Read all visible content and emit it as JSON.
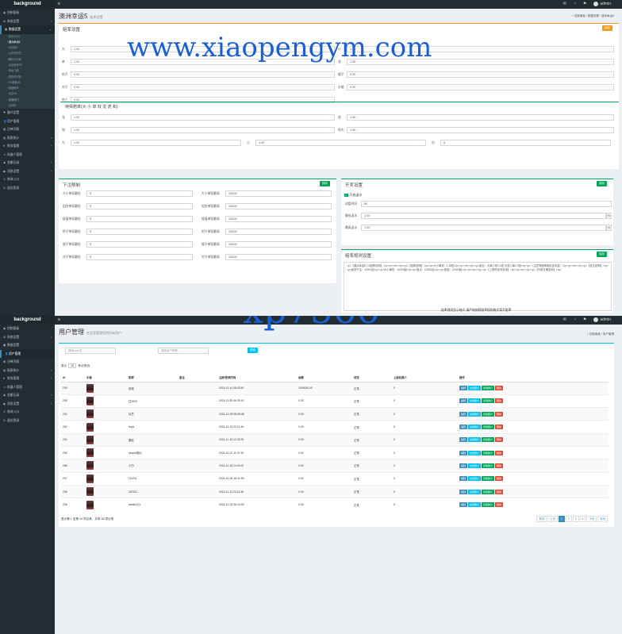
{
  "app": {
    "brand": "background",
    "user": "admin",
    "toggle_icon": "≡"
  },
  "sidebar1": [
    {
      "icon": "dashboard-icon",
      "glyph": "◉",
      "label": "控制面板",
      "arrow": ""
    },
    {
      "icon": "settings-icon",
      "glyph": "⚙",
      "label": "系统设置",
      "arrow": "‹"
    },
    {
      "icon": "data-icon",
      "glyph": "▦",
      "label": "数据设置",
      "arrow": "⌄",
      "active": true
    }
  ],
  "sidebar1_sub": [
    "加拿大2.8",
    "澳洲幸运5",
    "河北快3",
    "山东快乐扫",
    "腾讯分分彩",
    "北京赛车PK",
    "幸运飞艇",
    "重庆时时彩",
    "PC蛋蛋28",
    "极速赛车",
    "北京28",
    "新疆時时",
    "比特币"
  ],
  "sidebar1_rest": [
    {
      "icon": "flag-icon",
      "glyph": "⚑",
      "label": "备代设置",
      "arrow": ""
    },
    {
      "icon": "user-icon",
      "glyph": "👤",
      "label": "用户管理",
      "arrow": ""
    },
    {
      "icon": "bet-icon",
      "glyph": "▤",
      "label": "注单列表",
      "arrow": ""
    },
    {
      "icon": "report-icon",
      "glyph": "▥",
      "label": "报表统计",
      "arrow": "‹"
    },
    {
      "icon": "finance-icon",
      "glyph": "¥",
      "label": "财务管理",
      "arrow": "‹"
    },
    {
      "icon": "robot-icon",
      "glyph": "☺",
      "label": "机器人管理",
      "arrow": ""
    },
    {
      "icon": "agent-icon",
      "glyph": "♟",
      "label": "金额记录",
      "arrow": "‹"
    },
    {
      "icon": "bell-icon",
      "glyph": "◆",
      "label": "消息设置",
      "arrow": "‹"
    },
    {
      "icon": "key-icon",
      "glyph": "⚿",
      "label": "修改入口",
      "arrow": ""
    },
    {
      "icon": "logout-icon",
      "glyph": "⏻",
      "label": "退出登录",
      "arrow": ""
    }
  ],
  "sidebar2": [
    {
      "icon": "dashboard-icon",
      "glyph": "◉",
      "label": "控制面板",
      "arrow": ""
    },
    {
      "icon": "settings-icon",
      "glyph": "⚙",
      "label": "系统设置",
      "arrow": "‹"
    },
    {
      "icon": "data-icon",
      "glyph": "▦",
      "label": "数据设置",
      "arrow": ""
    },
    {
      "icon": "user-icon",
      "glyph": "👤",
      "label": "用户管理",
      "arrow": "",
      "active": true
    },
    {
      "icon": "bet-icon",
      "glyph": "▤",
      "label": "注单列表",
      "arrow": ""
    },
    {
      "icon": "report-icon",
      "glyph": "▥",
      "label": "报表统计",
      "arrow": "‹"
    },
    {
      "icon": "finance-icon",
      "glyph": "¥",
      "label": "财务管理",
      "arrow": "‹"
    },
    {
      "icon": "robot-icon",
      "glyph": "☺",
      "label": "机器人管理",
      "arrow": ""
    },
    {
      "icon": "agent-icon",
      "glyph": "♟",
      "label": "金额记录",
      "arrow": "‹"
    },
    {
      "icon": "bell-icon",
      "glyph": "◆",
      "label": "消息设置",
      "arrow": "‹"
    },
    {
      "icon": "key-icon",
      "glyph": "⚿",
      "label": "修改入口",
      "arrow": ""
    },
    {
      "icon": "logout-icon",
      "glyph": "⏻",
      "label": "退出登录",
      "arrow": ""
    }
  ],
  "page1": {
    "title": "澳洲幸运5",
    "subtitle": "赔率设置",
    "crumb": "⌂ 控制面板 › 数据设置 › 澳洲幸运5",
    "odds": {
      "title": "赔率设置",
      "save": "保存",
      "fields": [
        {
          "label": "大",
          "value": "1.90"
        },
        {
          "label": "小",
          "value": "1.90"
        },
        {
          "label": "单",
          "value": "1.90"
        },
        {
          "label": "双",
          "value": "1.90"
        },
        {
          "label": "豹子",
          "value": "9.90"
        },
        {
          "label": "顺子",
          "value": "9.90"
        },
        {
          "label": "对子",
          "value": "9.90"
        },
        {
          "label": "半顺",
          "value": "9.90"
        },
        {
          "label": "杂六",
          "value": "9.90"
        }
      ],
      "special_title": "特殊赔率(大 小 单 双 龙 虎 和)",
      "special": [
        {
          "label": "龙",
          "value": "1.90"
        },
        {
          "label": "虎",
          "value": "1.90"
        },
        {
          "label": "和",
          "value": "1.90"
        },
        {
          "label": "和大",
          "value": "1.90"
        }
      ],
      "triple": [
        {
          "label": "大",
          "value": "1.90"
        },
        {
          "label": "小",
          "value": "1.90"
        },
        {
          "label": "白",
          "value": "5"
        }
      ]
    },
    "limits": {
      "title": "下注限制",
      "save": "保存",
      "rows": [
        {
          "l1": "大小单双最低",
          "v1": "5",
          "l2": "大小单双最高",
          "v2": "10000"
        },
        {
          "l1": "组合单双最低",
          "v1": "5",
          "l2": "组合单双最高",
          "v2": "10000"
        },
        {
          "l1": "极值单双最低",
          "v1": "5",
          "l2": "极值单双最高",
          "v2": "10000"
        },
        {
          "l1": "豹子单双最低",
          "v1": "5",
          "l2": "豹子单双最高",
          "v2": "10000"
        },
        {
          "l1": "顺子单双最低",
          "v1": "5",
          "l2": "顺子单双最高",
          "v2": "10000"
        },
        {
          "l1": "对子单双最低",
          "v1": "5",
          "l2": "对子单双最高",
          "v2": "10000"
        }
      ]
    },
    "rebate": {
      "title": "开奖设置",
      "save": "保存",
      "switch": "开启返水",
      "fields": [
        {
          "label": "封盘时间",
          "value": "60",
          "unit": ""
        },
        {
          "label": "最低返水",
          "value": "1.00",
          "unit": "%"
        },
        {
          "label": "最高返水",
          "value": "1.00",
          "unit": "%"
        }
      ]
    },
    "rules": {
      "title": "赔率规则设置",
      "save": "保存",
      "text": "<p>【澳洲幸运5 1:5赔率说明】</p><p><br></p><p>【赔率说明】</p><p>大小单双：1.98倍</p><p><br></p><p>组合：大单小双1.4倍 大双小单1.9倍</p><p>（注意有赔率都包含本金）</p><p><br></p><p>【投注说明】</p><p>最低下注：10000起</p><p>大小单双：10000起</p><p>组合：10000起</p><p>极值：10000起</p><p><br></p><p>【上期开奖号查询】</p><p><br></p><p>【开奖日期查询】</p>",
      "note": "赔率规则显示格式 请严格按照赔率规则格式填写赔率"
    }
  },
  "page2": {
    "title": "用户管理",
    "subtitle": "在这里管理您的所有用户",
    "crumb": "⌂ 控制面板 › 用户管理",
    "search1": "搜索user名",
    "search2": "搜索用户昵称...",
    "search_btn": "搜索",
    "len_pre": "显示",
    "len_val": "10",
    "len_post": "条记录/页",
    "columns": [
      "ID",
      "头像",
      "昵称",
      "备注",
      "注册/登录时间",
      "余额",
      "状态",
      "上级机器人",
      "操作"
    ],
    "rows": [
      {
        "id": "233",
        "nick": "张强",
        "note": "",
        "time": "2024-11-14 08:33:50",
        "bal": "1000000.00",
        "st": "正常",
        "up": "0"
      },
      {
        "id": "208",
        "nick": "拉2000",
        "note": "",
        "time": "2024-11-05 06:25:19",
        "bal": "0.00",
        "st": "正常",
        "up": "0"
      },
      {
        "id": "241",
        "nick": "队员",
        "note": "",
        "time": "2024-10-28 08:08:48",
        "bal": "0.00",
        "st": "正常",
        "up": "0"
      },
      {
        "id": "262",
        "nick": "boys",
        "note": "",
        "time": "2024-10-31 23:11:45",
        "bal": "0.00",
        "st": "正常",
        "up": "0"
      },
      {
        "id": "224",
        "nick": "果粒",
        "note": "",
        "time": "2024-11-15 12:33:30",
        "bal": "0.00",
        "st": "正常",
        "up": "0"
      },
      {
        "id": "205",
        "nick": "simple相似",
        "note": "",
        "time": "2024-10-27 11:47:30",
        "bal": "0.00",
        "st": "正常",
        "up": "0"
      },
      {
        "id": "266",
        "nick": "小白",
        "note": "",
        "time": "2024-11-18 14:01:00",
        "bal": "0.00",
        "st": "正常",
        "up": "0"
      },
      {
        "id": "207",
        "nick": "111211",
        "note": "",
        "time": "2024-10-26 18:41:59",
        "bal": "0.00",
        "st": "正常",
        "up": "0"
      },
      {
        "id": "238",
        "nick": "302321",
        "note": "",
        "time": "2024-11-13 23:11:35",
        "bal": "0.00",
        "st": "正常",
        "up": "0"
      },
      {
        "id": "206",
        "nick": "admin123",
        "note": "",
        "time": "2024-10-26 06:24:09",
        "bal": "0.00",
        "st": "正常",
        "up": "0"
      }
    ],
    "actions": [
      "编辑",
      "充值账户",
      "扣除账户",
      "删除"
    ],
    "info": "显示第 1 至第 10 项记录，共有 48 项记录",
    "pager": [
      "首页",
      "上页",
      "1",
      "2",
      "3",
      "4",
      "下页",
      "末页"
    ]
  },
  "watermarks": [
    "www.xiaopengym.com",
    "xp7566"
  ]
}
